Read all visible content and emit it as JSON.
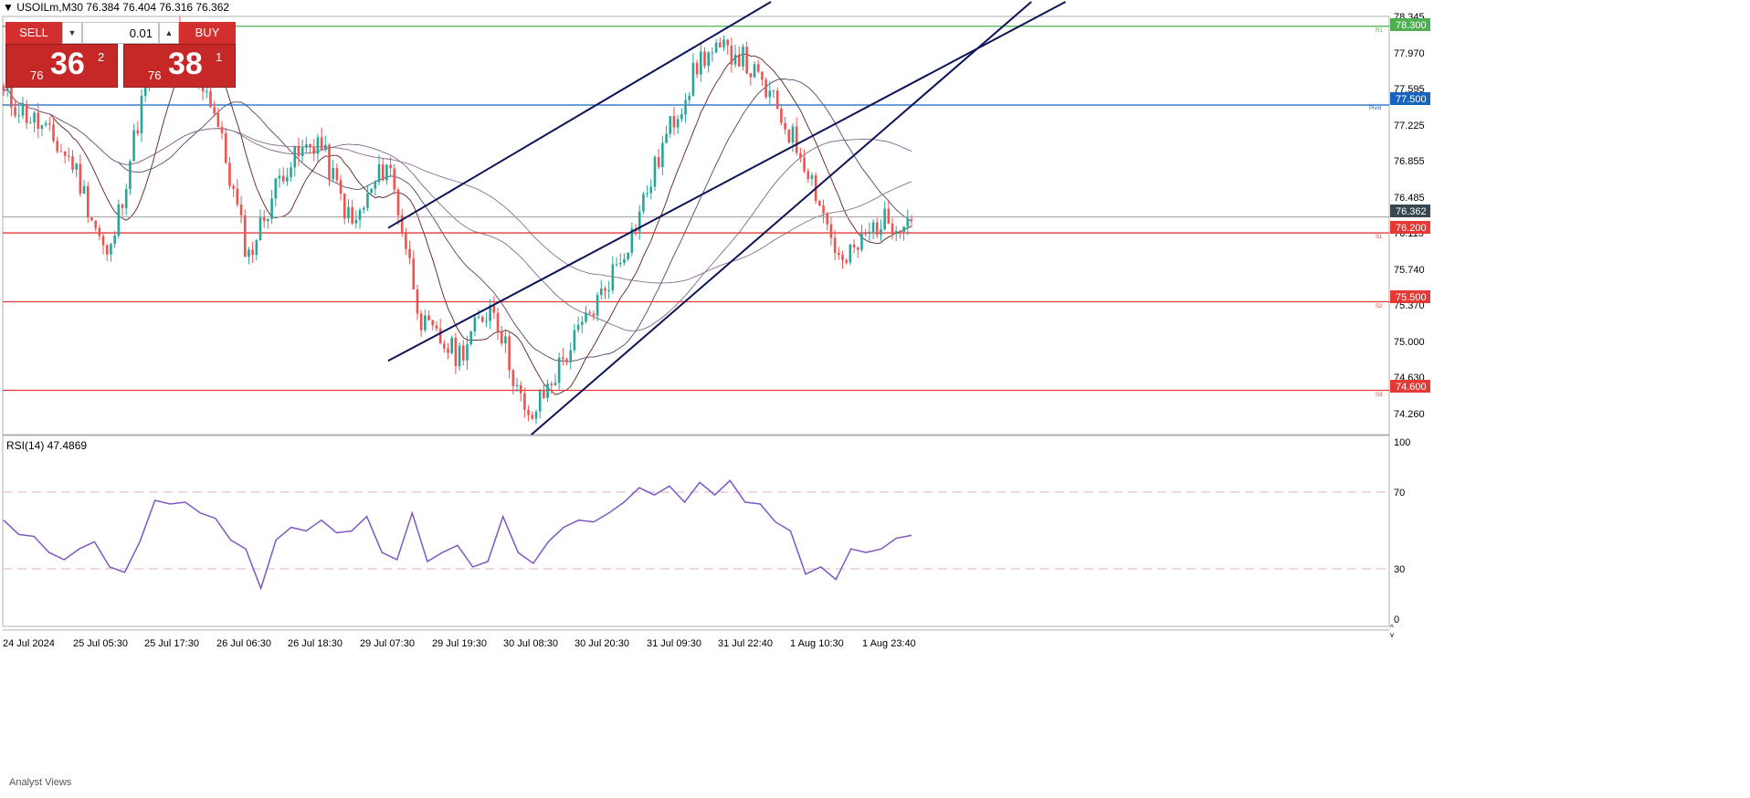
{
  "header": {
    "symbol": "USOILm,M30",
    "ohlc": "76.384 76.404 76.316 76.362"
  },
  "trade_panel": {
    "sell_label": "SELL",
    "buy_label": "BUY",
    "lot_value": "0.01",
    "sell_price": {
      "prefix": "76",
      "big": "36",
      "sup": "2"
    },
    "buy_price": {
      "prefix": "76",
      "big": "38",
      "sup": "1"
    }
  },
  "price_axis_labels": [
    "78.345",
    "77.970",
    "77.595",
    "77.225",
    "76.855",
    "76.485",
    "76.115",
    "75.740",
    "75.370",
    "75.000",
    "74.630",
    "74.260"
  ],
  "price_tags": {
    "r1": "78.300",
    "pivot": "77.500",
    "current": "76.362",
    "s1": "76.200",
    "s2": "75.500",
    "s3": "74.600"
  },
  "level_labels": {
    "r1": "R1",
    "pivot": "Pivot",
    "s1": "S1",
    "s2": "S2",
    "s3": "S3"
  },
  "rsi": {
    "title": "RSI(14) 47.4869",
    "axis_labels": [
      "100",
      "70",
      "30",
      "0"
    ]
  },
  "time_labels": [
    "24 Jul 2024",
    "25 Jul 05:30",
    "25 Jul 17:30",
    "26 Jul 06:30",
    "26 Jul 18:30",
    "29 Jul 07:30",
    "29 Jul 19:30",
    "30 Jul 08:30",
    "30 Jul 20:30",
    "31 Jul 09:30",
    "31 Jul 22:40",
    "1 Aug 10:30",
    "1 Aug 23:40"
  ],
  "bottom_tab": "Analyst Views",
  "colors": {
    "bull": "#26a69a",
    "bear": "#ef5350",
    "pivot": "#1565c0",
    "r1": "#4caf50",
    "support": "#e53935",
    "channel": "#0d1457",
    "rsi_line": "#7e57c2"
  },
  "chart_data": [
    {
      "type": "candlestick",
      "symbol": "USOILm",
      "timeframe": "M30",
      "y_range": [
        74.15,
        78.4
      ],
      "close_path": [
        {
          "t": "24 Jul 2024",
          "close": 77.6
        },
        {
          "t": "24 Jul late",
          "close": 77.3
        },
        {
          "t": "24 Jul night",
          "close": 76.9
        },
        {
          "t": "25 Jul 05:30",
          "close": 75.9
        },
        {
          "t": "25 Jul 12:00",
          "close": 77.6
        },
        {
          "t": "25 Jul 17:30",
          "close": 78.25
        },
        {
          "t": "26 Jul 06:30",
          "close": 77.5
        },
        {
          "t": "26 Jul 12:00",
          "close": 75.95
        },
        {
          "t": "26 Jul 18:30",
          "close": 76.85
        },
        {
          "t": "26 Jul 22:00",
          "close": 77.15
        },
        {
          "t": "29 Jul 04:00",
          "close": 76.25
        },
        {
          "t": "29 Jul 07:30",
          "close": 76.95
        },
        {
          "t": "29 Jul 11:00",
          "close": 75.25
        },
        {
          "t": "29 Jul 19:30",
          "close": 74.95
        },
        {
          "t": "30 Jul 02:00",
          "close": 75.5
        },
        {
          "t": "30 Jul 08:30",
          "close": 74.25
        },
        {
          "t": "30 Jul 14:00",
          "close": 74.9
        },
        {
          "t": "30 Jul 20:30",
          "close": 75.5
        },
        {
          "t": "31 Jul 02:00",
          "close": 76.2
        },
        {
          "t": "31 Jul 09:30",
          "close": 77.2
        },
        {
          "t": "31 Jul 16:00",
          "close": 78.0
        },
        {
          "t": "31 Jul 22:40",
          "close": 78.05
        },
        {
          "t": "1 Aug 04:00",
          "close": 77.55
        },
        {
          "t": "1 Aug 08:00",
          "close": 76.9
        },
        {
          "t": "1 Aug 10:30",
          "close": 75.85
        },
        {
          "t": "1 Aug 16:00",
          "close": 76.3
        },
        {
          "t": "1 Aug 23:40",
          "close": 76.36
        }
      ],
      "horizontal_levels": [
        {
          "name": "R1",
          "value": 78.3
        },
        {
          "name": "Pivot",
          "value": 77.5
        },
        {
          "name": "S1",
          "value": 76.2
        },
        {
          "name": "S2",
          "value": 75.5
        },
        {
          "name": "S3",
          "value": 74.6
        }
      ],
      "last_price": 76.362,
      "trend_channel_lines": [
        {
          "from": {
            "t": "29 Jul 07:30",
            "price": 76.25
          },
          "to": {
            "t": "31 Jul 22:40",
            "price": 78.4
          }
        },
        {
          "from": {
            "t": "29 Jul 07:30",
            "price": 74.9
          },
          "to": {
            "t": "1 Aug 23:40",
            "price": 77.6
          }
        },
        {
          "from": {
            "t": "30 Jul 08:30",
            "price": 74.15
          },
          "to": {
            "t": "1 Aug 23:40",
            "price": 77.3
          }
        }
      ],
      "moving_averages": 4
    },
    {
      "type": "line",
      "title": "RSI(14) 47.4869",
      "ylim": [
        0,
        100
      ],
      "levels": [
        70,
        30
      ],
      "series": [
        {
          "name": "RSI(14)",
          "values": [
            56,
            48,
            47,
            38,
            34,
            40,
            44,
            30,
            27,
            44,
            67,
            65,
            66,
            60,
            57,
            45,
            40,
            18,
            45,
            52,
            50,
            56,
            49,
            50,
            58,
            38,
            34,
            60,
            33,
            38,
            42,
            30,
            33,
            58,
            38,
            32,
            44,
            52,
            56,
            55,
            60,
            66,
            74,
            70,
            75,
            66,
            77,
            70,
            78,
            66,
            65,
            55,
            50,
            26,
            30,
            23,
            40,
            38,
            40,
            46,
            47.5
          ]
        }
      ]
    }
  ]
}
